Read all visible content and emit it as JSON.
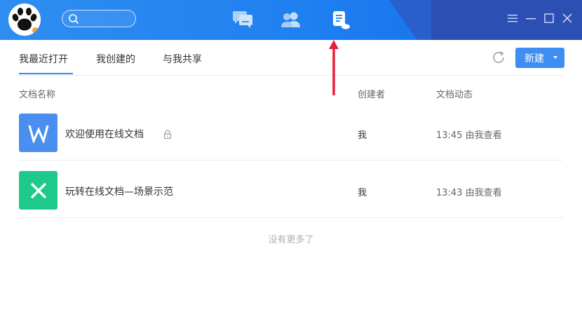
{
  "titlebar": {
    "nav_icons": [
      "chat-icon",
      "contacts-icon",
      "documents-icon"
    ],
    "window_controls": [
      "menu-icon",
      "minimize-icon",
      "maximize-icon",
      "close-icon"
    ]
  },
  "tabs": [
    {
      "label": "我最近打开",
      "active": true
    },
    {
      "label": "我创建的",
      "active": false
    },
    {
      "label": "与我共享",
      "active": false
    }
  ],
  "toolbar": {
    "new_label": "新建"
  },
  "columns": {
    "name": "文档名称",
    "creator": "创建者",
    "activity": "文档动态"
  },
  "documents": [
    {
      "icon": "word-doc-icon",
      "letter": "W",
      "name": "欢迎使用在线文档",
      "locked": true,
      "creator": "我",
      "activity": "13:45 由我查看",
      "color": "#4a8ff0"
    },
    {
      "icon": "excel-sheet-icon",
      "letter": "X",
      "name": "玩转在线文档—场景示范",
      "locked": false,
      "creator": "我",
      "activity": "13:43 由我查看",
      "color": "#1ec98c"
    }
  ],
  "footer": {
    "no_more": "没有更多了"
  },
  "colors": {
    "accent": "#2d8cf0",
    "titlebar": "#1e7ff0",
    "annotation_arrow": "#e8213a"
  }
}
